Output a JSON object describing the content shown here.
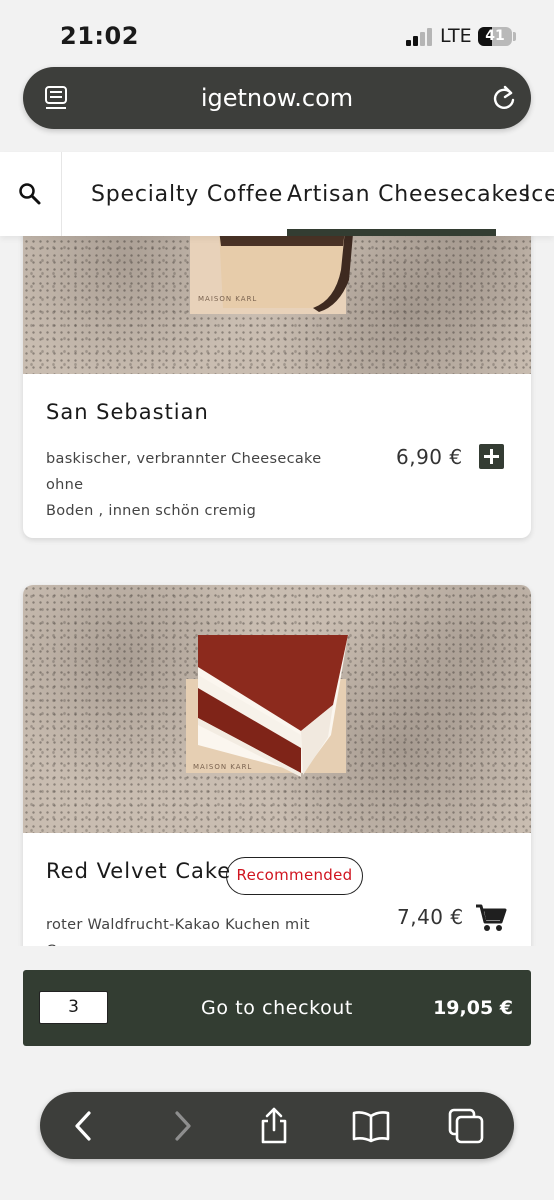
{
  "status_bar": {
    "time": "21:02",
    "network": "LTE",
    "battery_level": "41",
    "battery_fraction": 0.41
  },
  "browser": {
    "url": "igetnow.com",
    "icons": [
      "reader-mode-icon",
      "reload-icon"
    ]
  },
  "categories": {
    "items": [
      {
        "label": "Specialty Coffee"
      },
      {
        "label": "Artisan Cheesecakes",
        "active": true
      },
      {
        "label": "Ice"
      }
    ]
  },
  "products": [
    {
      "name": "San Sebastian",
      "description_line1": "baskischer, verbrannter Cheesecake ohne",
      "description_line2": "Boden , innen schön cremig",
      "price": "6,90 €",
      "action_icon": "plus-icon",
      "image_label": "MAISON KARL"
    },
    {
      "name": "Red Velvet Cake",
      "badge": "Recommended",
      "description_line1": "roter Waldfrucht-Kakao Kuchen mit Cream",
      "price": "7,40 €",
      "action_icon": "cart-icon",
      "image_label": "MAISON KARL"
    }
  ],
  "checkout": {
    "quantity": "3",
    "label": "Go to checkout",
    "total": "19,05 €"
  },
  "colors": {
    "brand_dark": "#333d32",
    "browser_chrome": "#3d3e3b",
    "badge_text": "#d0141f"
  },
  "toolbar": {
    "icons": [
      "back-icon",
      "forward-icon",
      "share-icon",
      "bookmarks-icon",
      "tabs-icon"
    ]
  }
}
